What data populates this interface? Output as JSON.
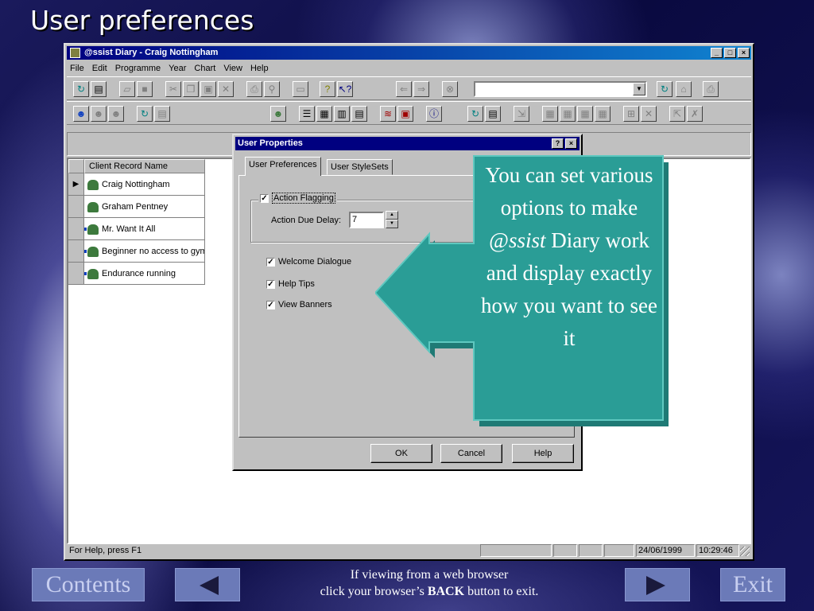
{
  "slide": {
    "title": "User preferences"
  },
  "app": {
    "window_title": "@ssist Diary - Craig Nottingham",
    "window_buttons": [
      "_",
      "□",
      "×"
    ],
    "menu": [
      "File",
      "Edit",
      "Programme",
      "Year",
      "Chart",
      "View",
      "Help"
    ],
    "combo_value": "",
    "grid_header": "Client Record Name",
    "rows": [
      {
        "name": "Craig Nottingham",
        "current": true,
        "icon": "person-icon"
      },
      {
        "name": "Graham Pentney",
        "current": false,
        "icon": "person-icon"
      },
      {
        "name": "Mr. Want It All",
        "current": false,
        "icon": "person-arrow-icon"
      },
      {
        "name": "Beginner no access to gym",
        "current": false,
        "icon": "person-arrow-icon"
      },
      {
        "name": "Endurance running",
        "current": false,
        "icon": "person-arrow-icon"
      }
    ],
    "status": {
      "help_text": "For Help, press F1",
      "date": "24/06/1999",
      "time": "10:29:46"
    }
  },
  "dialog": {
    "title": "User Properties",
    "title_buttons": [
      "?",
      "×"
    ],
    "tabs": [
      "User Preferences",
      "User StyleSets"
    ],
    "action_flagging": {
      "label": "Action Flagging",
      "checked": true
    },
    "delay": {
      "label": "Action Due Delay:",
      "value": "7"
    },
    "options": [
      {
        "label": "Welcome Dialogue",
        "checked": true
      },
      {
        "label": "Help Tips",
        "checked": true
      },
      {
        "label": "View Banners",
        "checked": true
      }
    ],
    "buttons": {
      "ok": "OK",
      "cancel": "Cancel",
      "help": "Help"
    }
  },
  "callout": {
    "line1": "You can set various options to make @",
    "italic": "ssist",
    "line2": "Diary  work and display exactly how you want to see it",
    "color": "#2a9d96"
  },
  "nav": {
    "contents": "Contents",
    "exit": "Exit",
    "note_line1": "If viewing from a web browser",
    "note_line2a": "click your browser’s ",
    "note_bold": "BACK",
    "note_line2b": " button to exit."
  }
}
